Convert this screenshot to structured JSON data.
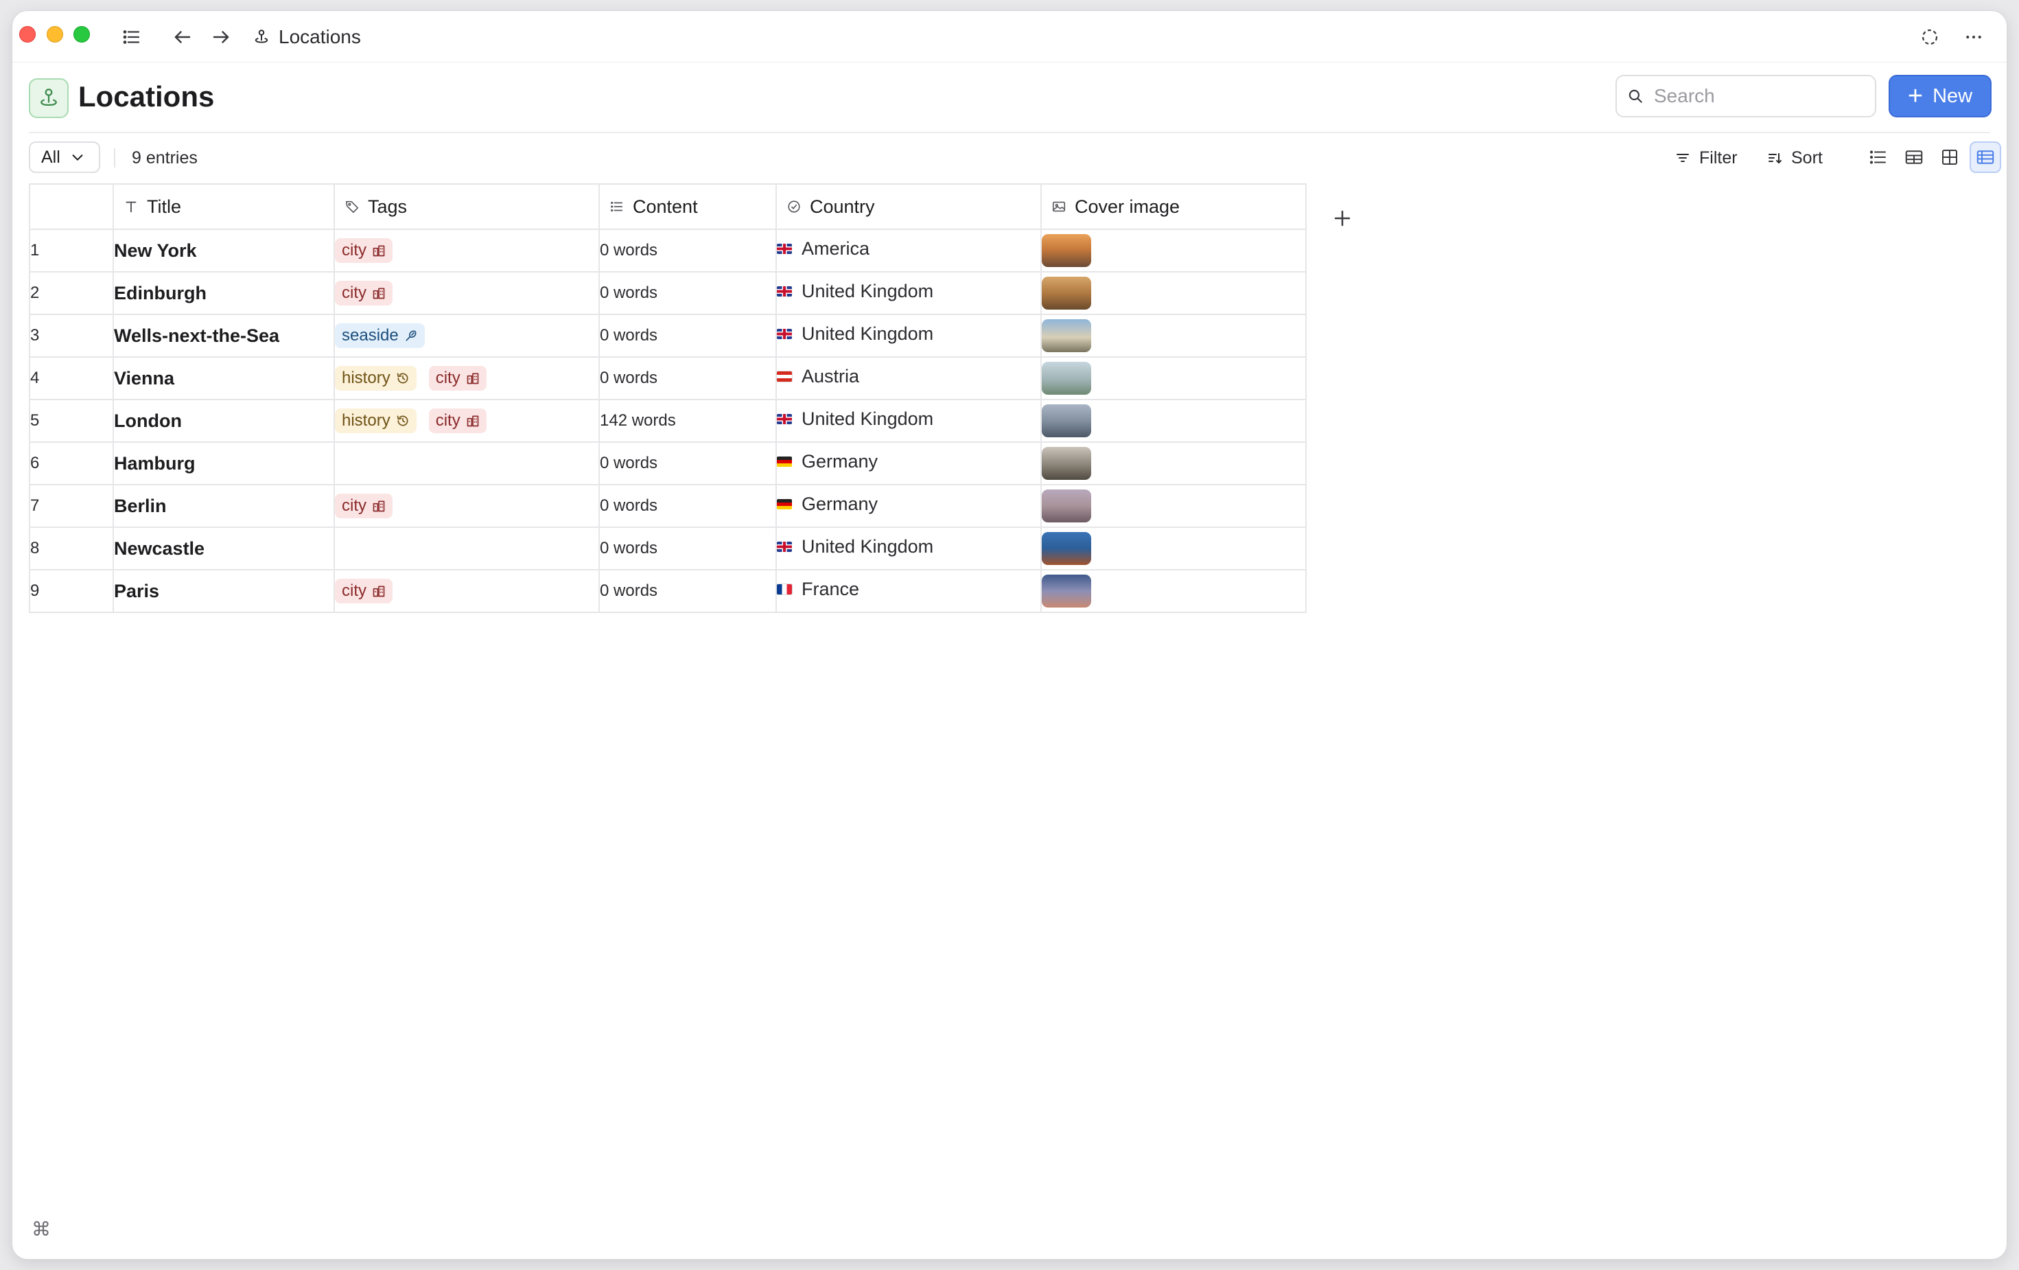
{
  "window": {
    "title": "Locations"
  },
  "header": {
    "title": "Locations",
    "search_placeholder": "Search",
    "new_label": "New"
  },
  "toolbar": {
    "view_selected": "All",
    "entries": "9 entries",
    "filter_label": "Filter",
    "sort_label": "Sort"
  },
  "table": {
    "columns": {
      "title": "Title",
      "tags": "Tags",
      "content": "Content",
      "country": "Country",
      "cover": "Cover image"
    },
    "rows": [
      {
        "num": "1",
        "title": "New York",
        "tags": [
          "city"
        ],
        "content": "0 words",
        "country": "America",
        "flag": "uk",
        "cover": "orange"
      },
      {
        "num": "2",
        "title": "Edinburgh",
        "tags": [
          "city"
        ],
        "content": "0 words",
        "country": "United Kingdom",
        "flag": "uk",
        "cover": "amber"
      },
      {
        "num": "3",
        "title": "Wells-next-the-Sea",
        "tags": [
          "seaside"
        ],
        "content": "0 words",
        "country": "United Kingdom",
        "flag": "uk",
        "cover": "sky"
      },
      {
        "num": "4",
        "title": "Vienna",
        "tags": [
          "history",
          "city"
        ],
        "content": "0 words",
        "country": "Austria",
        "flag": "at",
        "cover": "pale"
      },
      {
        "num": "5",
        "title": "London",
        "tags": [
          "history",
          "city"
        ],
        "content": "142 words",
        "country": "United Kingdom",
        "flag": "uk",
        "cover": "grey"
      },
      {
        "num": "6",
        "title": "Hamburg",
        "tags": [],
        "content": "0 words",
        "country": "Germany",
        "flag": "de",
        "cover": "dusk"
      },
      {
        "num": "7",
        "title": "Berlin",
        "tags": [
          "city"
        ],
        "content": "0 words",
        "country": "Germany",
        "flag": "de",
        "cover": "mauve"
      },
      {
        "num": "8",
        "title": "Newcastle",
        "tags": [],
        "content": "0 words",
        "country": "United Kingdom",
        "flag": "uk",
        "cover": "blue"
      },
      {
        "num": "9",
        "title": "Paris",
        "tags": [
          "city"
        ],
        "content": "0 words",
        "country": "France",
        "flag": "fr",
        "cover": "twilight"
      }
    ]
  },
  "footer": {
    "command_symbol": "⌘"
  }
}
